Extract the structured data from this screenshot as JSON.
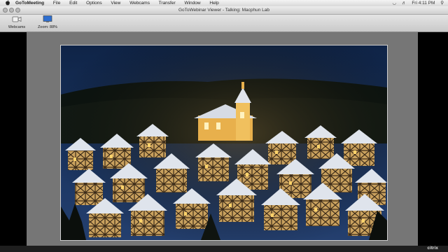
{
  "menubar": {
    "app_name": "GoToMeeting",
    "menus": [
      "File",
      "Edit",
      "Options",
      "View",
      "Webcams",
      "Transfer",
      "Window",
      "Help"
    ],
    "status_clock": "Fri 4:11 PM"
  },
  "window": {
    "title": "GoToWebinar Viewer - Talking: Macphun  Lab"
  },
  "toolbar": {
    "webcams_label": "Webcams",
    "zoom_label": "Zoom: 88%"
  },
  "viewer": {
    "shared_image": "snowy village at night"
  },
  "footer": {
    "brand": "citrix"
  },
  "colors": {
    "toolbar_bg": "#d6d6d6",
    "viewer_gray": "#767676",
    "night_sky": "#152a4d"
  }
}
